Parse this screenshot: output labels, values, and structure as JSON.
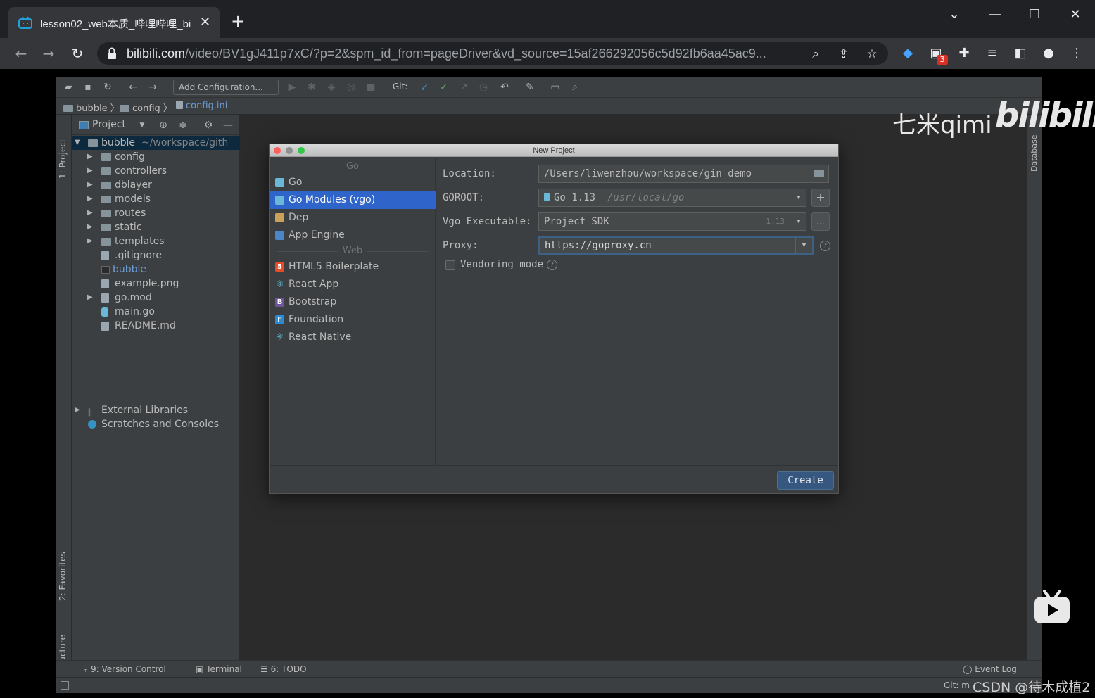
{
  "browser": {
    "tab_title": "lesson02_web本质_哔哩哔哩_bi",
    "url_host": "bilibili.com",
    "url_rest": "/video/BV1gJ411p7xC/?p=2&spm_id_from=pageDriver&vd_source=15af266292056c5d92fb6aa45ac9...",
    "extension_badge": "3"
  },
  "ide": {
    "toolbar": {
      "add_config": "Add Configuration...",
      "git_label": "Git:"
    },
    "breadcrumbs": [
      "bubble",
      "config",
      "config.ini"
    ],
    "left_tabs": [
      "1: Project",
      "2: Favorites",
      "Z: Structure"
    ],
    "right_tabs": [
      "Database"
    ],
    "project_panel": {
      "title": "Project",
      "root_name": "bubble",
      "root_path": "~/workspace/gith",
      "items": [
        {
          "label": "config",
          "kind": "folder"
        },
        {
          "label": "controllers",
          "kind": "folder"
        },
        {
          "label": "dblayer",
          "kind": "folder"
        },
        {
          "label": "models",
          "kind": "folder"
        },
        {
          "label": "routes",
          "kind": "folder"
        },
        {
          "label": "static",
          "kind": "folder"
        },
        {
          "label": "templates",
          "kind": "folder"
        },
        {
          "label": ".gitignore",
          "kind": "file"
        },
        {
          "label": "bubble",
          "kind": "binary"
        },
        {
          "label": "example.png",
          "kind": "file"
        },
        {
          "label": "go.mod",
          "kind": "file"
        },
        {
          "label": "main.go",
          "kind": "go"
        },
        {
          "label": "README.md",
          "kind": "file"
        }
      ],
      "external_libraries": "External Libraries",
      "scratches": "Scratches and Consoles"
    },
    "bottom_tools": {
      "version_control": "9: Version Control",
      "terminal": "Terminal",
      "todo": "6: TODO",
      "event_log": "Event Log"
    },
    "status": {
      "git": "Git: m"
    }
  },
  "dialog": {
    "title": "New Project",
    "groups": [
      "Go",
      "Web"
    ],
    "go_types": [
      "Go",
      "Go Modules (vgo)",
      "Dep",
      "App Engine"
    ],
    "web_types": [
      "HTML5 Boilerplate",
      "React App",
      "Bootstrap",
      "Foundation",
      "React Native"
    ],
    "selected": "Go Modules (vgo)",
    "form": {
      "location_label": "Location:",
      "location_value": "/Users/liwenzhou/workspace/gin_demo",
      "goroot_label": "GOROOT:",
      "goroot_version": "Go 1.13",
      "goroot_path": "/usr/local/go",
      "vgo_label": "Vgo Executable:",
      "vgo_value": "Project SDK",
      "vgo_version": "1.13",
      "proxy_label": "Proxy:",
      "proxy_value": "https://goproxy.cn",
      "vendoring_label": "Vendoring mode",
      "vendoring_checked": false
    },
    "create_button": "Create"
  },
  "watermarks": {
    "author": "七米qimi",
    "site": "bilibili",
    "csdn": "CSDN @待木成植2"
  },
  "colors": {
    "accent_selection": "#2f65ca",
    "create_button": "#365880",
    "ide_background": "#2b2b2b",
    "panel_background": "#3c3f41"
  }
}
